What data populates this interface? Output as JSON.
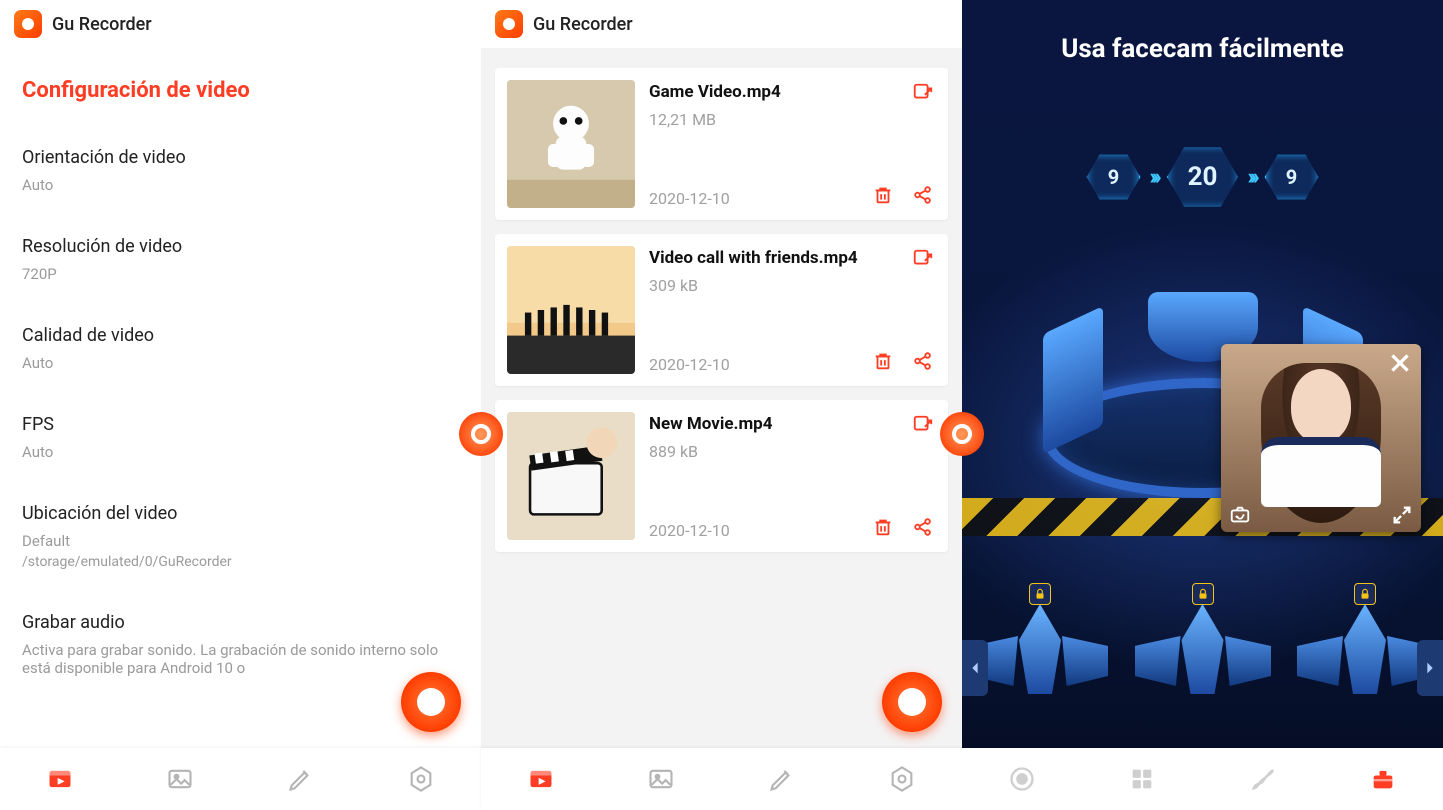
{
  "app": {
    "title": "Gu Recorder"
  },
  "colors": {
    "accent": "#ff3d24"
  },
  "panel1": {
    "section_title": "Configuración de video",
    "settings": [
      {
        "label": "Orientación de video",
        "value": "Auto"
      },
      {
        "label": "Resolución de video",
        "value": "720P"
      },
      {
        "label": "Calidad de video",
        "value": "Auto"
      },
      {
        "label": "FPS",
        "value": "Auto"
      },
      {
        "label": "Ubicación del video",
        "value": "Default",
        "sub": "/storage/emulated/0/GuRecorder"
      },
      {
        "label": "Grabar audio",
        "value": "Activa para grabar sonido. La grabación de sonido interno solo está disponible para Android 10 o"
      }
    ]
  },
  "panel2": {
    "videos": [
      {
        "name": "Game Video.mp4",
        "size": "12,21 MB",
        "date": "2020-12-10"
      },
      {
        "name": "Video call with friends.mp4",
        "size": "309 kB",
        "date": "2020-12-10"
      },
      {
        "name": "New Movie.mp4",
        "size": "889 kB",
        "date": "2020-12-10"
      }
    ]
  },
  "panel3": {
    "title": "Usa facecam fácilmente",
    "score": {
      "left": "9",
      "center": "20",
      "right": "9"
    },
    "ships_locked": [
      true,
      true,
      true
    ]
  },
  "nav": {
    "items": [
      {
        "name": "recordings-tab-icon"
      },
      {
        "name": "screenshots-tab-icon"
      },
      {
        "name": "edit-tab-icon"
      },
      {
        "name": "settings-tab-icon"
      }
    ],
    "items3": [
      {
        "name": "record-tab-icon"
      },
      {
        "name": "apps-tab-icon"
      },
      {
        "name": "brush-tab-icon"
      },
      {
        "name": "tools-tab-icon"
      }
    ]
  }
}
